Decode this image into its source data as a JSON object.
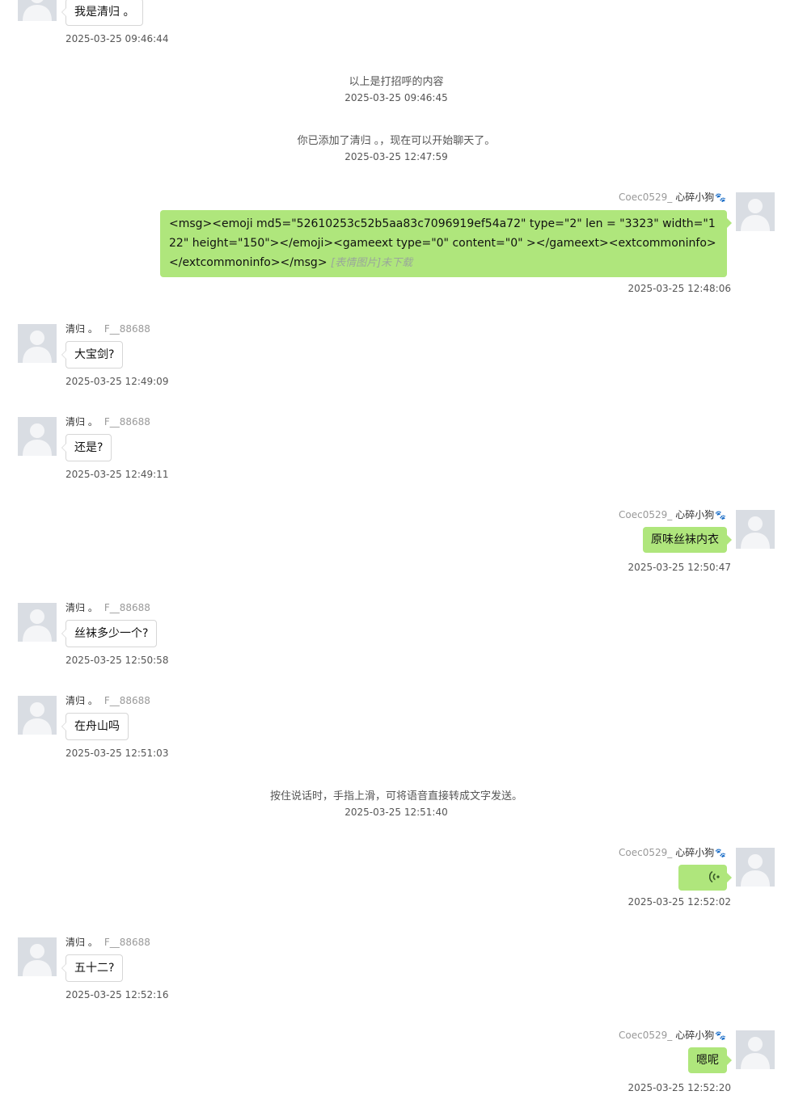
{
  "self": {
    "wechat_id": "Coec0529_",
    "nickname": "心碎小狗",
    "badge_icon": "paw-icon"
  },
  "peer": {
    "nickname": "清归 。",
    "wechat_id": "F__88688"
  },
  "msg0": {
    "text": "我是清归 。",
    "time": "2025-03-25 09:46:44"
  },
  "sys1": {
    "text": "以上是打招呼的内容",
    "time": "2025-03-25 09:46:45"
  },
  "sys2": {
    "text": "你已添加了清归 。，现在可以开始聊天了。",
    "time": "2025-03-25 12:47:59"
  },
  "out1": {
    "text": "<msg><emoji md5=\"52610253c52b5aa83c7096919ef54a72\" type=\"2\" len = \"3323\" width=\"122\" height=\"150\"></emoji><gameext type=\"0\" content=\"0\" ></gameext><extcommoninfo></extcommoninfo></msg>",
    "note": "[表情图片]未下载",
    "time": "2025-03-25 12:48:06"
  },
  "in1": {
    "text": "大宝剑?",
    "time": "2025-03-25 12:49:09"
  },
  "in2": {
    "text": "还是?",
    "time": "2025-03-25 12:49:11"
  },
  "out2": {
    "text": "原味丝袜内衣",
    "time": "2025-03-25 12:50:47"
  },
  "in3": {
    "text": "丝袜多少一个?",
    "time": "2025-03-25 12:50:58"
  },
  "in4": {
    "text": "在舟山吗",
    "time": "2025-03-25 12:51:03"
  },
  "sys3": {
    "text": "按住说话时，手指上滑，可将语音直接转成文字发送。",
    "time": "2025-03-25 12:51:40"
  },
  "out3": {
    "icon": "voice-wave-icon",
    "time": "2025-03-25 12:52:02"
  },
  "in5": {
    "text": "五十二?",
    "time": "2025-03-25 12:52:16"
  },
  "out4": {
    "text": "嗯呢",
    "time": "2025-03-25 12:52:20"
  },
  "colors": {
    "outgoing_bubble": "#afe67c",
    "incoming_bubble": "#ffffff",
    "avatar_placeholder": "#d9dde3"
  }
}
